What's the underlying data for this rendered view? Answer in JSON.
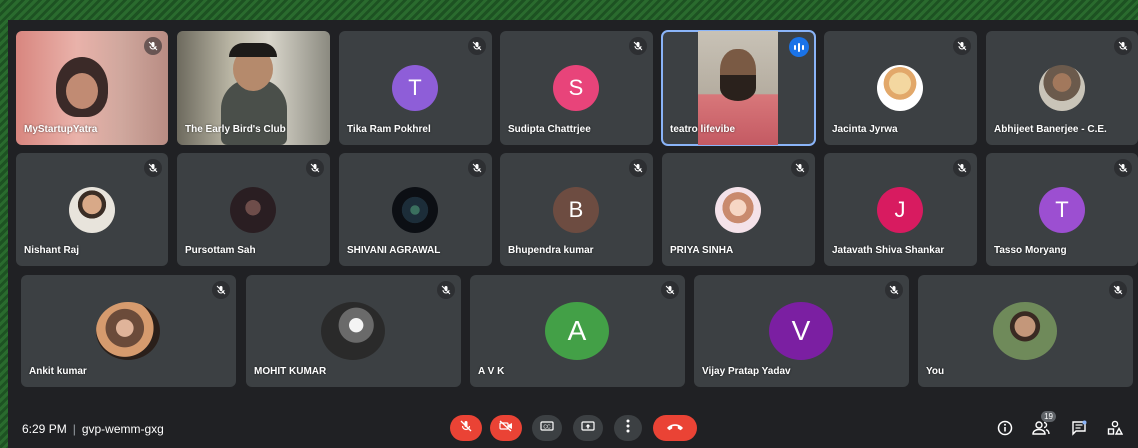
{
  "colors": {
    "tile": "#3c4043",
    "speaking": "#1a73e8",
    "end_call": "#ea4335"
  },
  "tiles": [
    {
      "name": "MyStartupYatra",
      "kind": "video"
    },
    {
      "name": "The Early Bird's Club",
      "kind": "video"
    },
    {
      "name": "Tika Ram Pokhrel",
      "initial": "T",
      "color": "#8e5ed8"
    },
    {
      "name": "Sudipta Chattrjee",
      "initial": "S",
      "color": "#e8447a"
    },
    {
      "name": "teatro lifevibe",
      "kind": "video",
      "speaking": true
    },
    {
      "name": "Jacinta Jyrwa",
      "kind": "photo"
    },
    {
      "name": "Abhijeet Banerjee - C.E.",
      "kind": "photo"
    },
    {
      "name": "Nishant Raj",
      "kind": "photo"
    },
    {
      "name": "Pursottam Sah",
      "kind": "photo"
    },
    {
      "name": "SHIVANI AGRAWAL",
      "kind": "photo"
    },
    {
      "name": "Bhupendra kumar",
      "initial": "B",
      "color": "#6d4c41"
    },
    {
      "name": "PRIYA SINHA",
      "kind": "photo"
    },
    {
      "name": "Jatavath Shiva Shankar",
      "initial": "J",
      "color": "#d81b60"
    },
    {
      "name": "Tasso Moryang",
      "initial": "T",
      "color": "#9c4fd1"
    },
    {
      "name": "Ankit kumar",
      "kind": "photo"
    },
    {
      "name": "MOHIT KUMAR",
      "kind": "photo"
    },
    {
      "name": "A V K",
      "initial": "A",
      "color": "#43a047"
    },
    {
      "name": "Vijay Pratap Yadav",
      "initial": "V",
      "color": "#7b1fa2"
    },
    {
      "name": "You",
      "kind": "photo"
    }
  ],
  "bottombar": {
    "time": "6:29 PM",
    "separator": "|",
    "meeting_code": "gvp-wemm-gxg",
    "people_count": "19",
    "icons": {
      "mic": "mic-off-icon",
      "camera": "camera-off-icon",
      "captions": "captions-icon",
      "present": "present-icon",
      "more": "more-vert-icon",
      "end": "call-end-icon",
      "info": "info-icon",
      "people": "people-icon",
      "chat": "chat-icon",
      "activities": "activities-icon"
    }
  }
}
